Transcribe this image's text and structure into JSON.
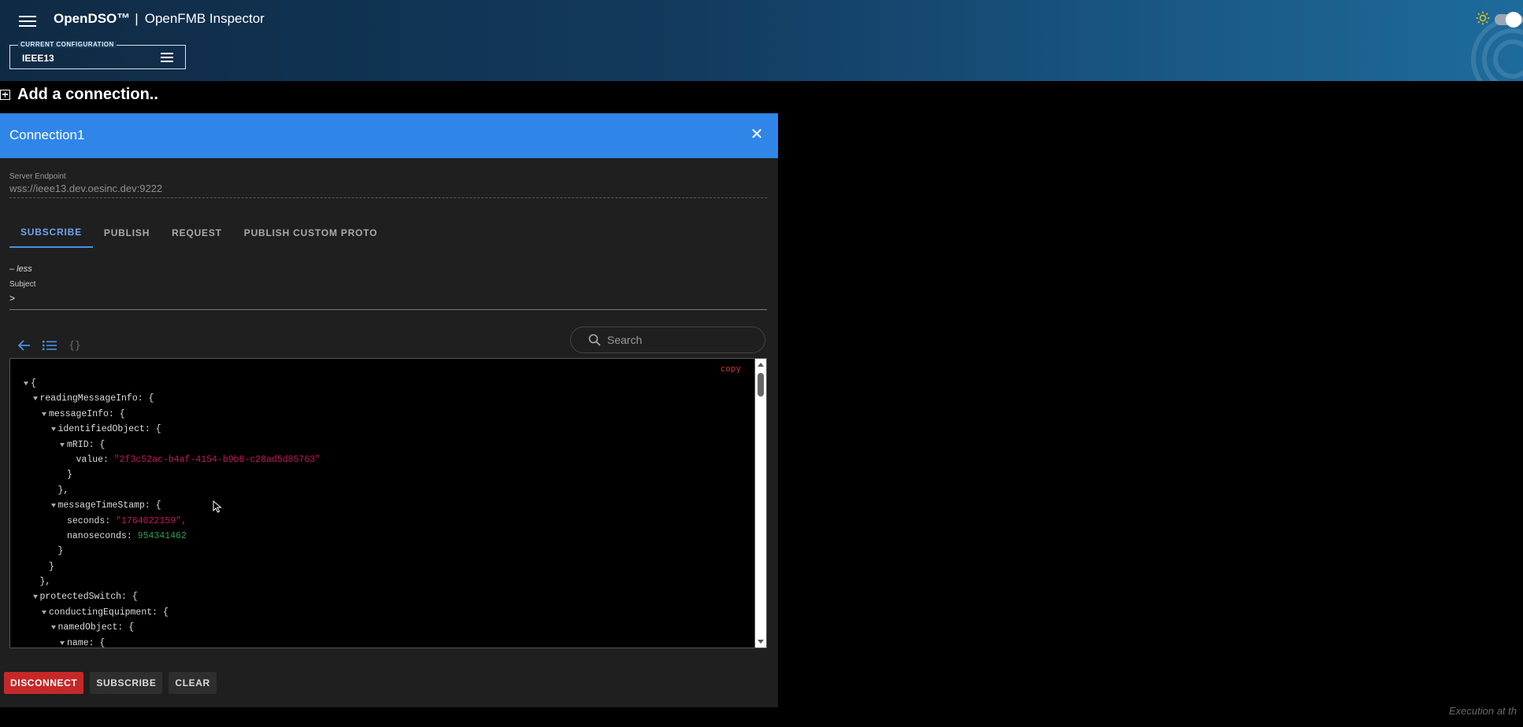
{
  "header": {
    "brand": "OpenDSO™",
    "separator": "|",
    "app_name": "OpenFMB Inspector",
    "config_label": "CURRENT CONFIGURATION",
    "config_value": "IEEE13"
  },
  "add_connection": {
    "label": "Add a connection.."
  },
  "connection": {
    "title": "Connection1",
    "endpoint_label": "Server Endpoint",
    "endpoint_value": "wss://ieee13.dev.oesinc.dev:9222",
    "tabs": [
      {
        "label": "SUBSCRIBE",
        "active": true
      },
      {
        "label": "PUBLISH",
        "active": false
      },
      {
        "label": "REQUEST",
        "active": false
      },
      {
        "label": "PUBLISH CUSTOM PROTO",
        "active": false
      }
    ],
    "less_label": "– less",
    "subject_label": "Subject",
    "subject_value": ">",
    "search_placeholder": "Search",
    "copy_label": "copy",
    "json_lines": [
      {
        "depth": 0,
        "key": "",
        "open": "{",
        "caret": true
      },
      {
        "depth": 1,
        "key": "readingMessageInfo",
        "open": "{",
        "caret": true
      },
      {
        "depth": 2,
        "key": "messageInfo",
        "open": "{",
        "caret": true
      },
      {
        "depth": 3,
        "key": "identifiedObject",
        "open": "{",
        "caret": true
      },
      {
        "depth": 4,
        "key": "mRID",
        "open": "{",
        "caret": true
      },
      {
        "depth": 5,
        "key": "value",
        "str": "\"2f3c52ac-b4af-4154-b9b8-c28ad5d85763\""
      },
      {
        "depth": 4,
        "close": "}"
      },
      {
        "depth": 3,
        "close": "},"
      },
      {
        "depth": 3,
        "key": "messageTimeStamp",
        "open": "{",
        "caret": true
      },
      {
        "depth": 4,
        "key": "seconds",
        "str": "\"1764022159\","
      },
      {
        "depth": 4,
        "key": "nanoseconds",
        "num": "954341462"
      },
      {
        "depth": 3,
        "close": "}"
      },
      {
        "depth": 2,
        "close": "}"
      },
      {
        "depth": 1,
        "close": "},"
      },
      {
        "depth": 1,
        "key": "protectedSwitch",
        "open": "{",
        "caret": true
      },
      {
        "depth": 2,
        "key": "conductingEquipment",
        "open": "{",
        "caret": true
      },
      {
        "depth": 3,
        "key": "namedObject",
        "open": "{",
        "caret": true
      },
      {
        "depth": 4,
        "key": "name",
        "open": "{",
        "caret": true
      }
    ],
    "buttons": {
      "disconnect": "DISCONNECT",
      "subscribe": "SUBSCRIBE",
      "clear": "CLEAR"
    }
  },
  "footer": {
    "exec_note": "Execution at th"
  },
  "colors": {
    "accent": "#2f86e8",
    "danger": "#c62828",
    "string": "#c2185b",
    "number": "#2e9e4f",
    "copy": "#c0392b"
  }
}
